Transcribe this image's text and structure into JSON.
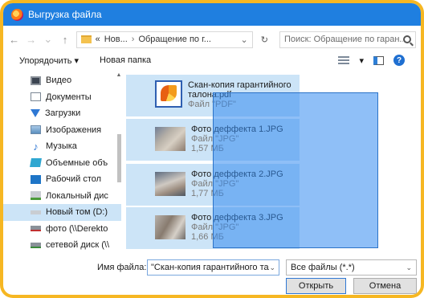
{
  "window": {
    "title": "Выгрузка файла"
  },
  "address": {
    "back_glyph": "←",
    "forward_glyph": "→",
    "history_glyph": "⌄",
    "up_glyph": "↑",
    "prefix": "«",
    "crumbs": [
      "Нов...",
      "Обращение по г..."
    ],
    "separator": "›",
    "dropdown_glyph": "⌄",
    "refresh_glyph": "↻",
    "search_placeholder": "Поиск: Обращение по гаран..."
  },
  "toolbar": {
    "organize_label": "Упорядочить ▾",
    "new_folder_label": "Новая папка",
    "view_dropdown_glyph": "▾",
    "help_glyph": "?"
  },
  "sidebar": {
    "items": [
      {
        "label": "Видео",
        "icon": "video-icon"
      },
      {
        "label": "Документы",
        "icon": "documents-icon"
      },
      {
        "label": "Загрузки",
        "icon": "downloads-icon"
      },
      {
        "label": "Изображения",
        "icon": "images-icon"
      },
      {
        "label": "Музыка",
        "icon": "music-icon"
      },
      {
        "label": "Объемные объ",
        "icon": "3d-objects-icon"
      },
      {
        "label": "Рабочий стол",
        "icon": "desktop-icon"
      },
      {
        "label": "Локальный дис",
        "icon": "local-disk-icon"
      },
      {
        "label": "Новый том (D:)",
        "icon": "drive-icon",
        "selected": true
      },
      {
        "label": "фото (\\\\Derekto",
        "icon": "network-drive-icon"
      },
      {
        "label": "сетевой диск (\\\\",
        "icon": "network-drive-icon"
      }
    ],
    "music_glyph": "♪",
    "scroll_up": "▲",
    "scroll_down": "▼"
  },
  "files": [
    {
      "name_line1": "Скан-копия гарантийного",
      "name_line2": "талона.pdf",
      "type": "Файл \"PDF\"",
      "size": ""
    },
    {
      "name_line1": "Фото деффекта 1.JPG",
      "name_line2": "",
      "type": "Файл \"JPG\"",
      "size": "1,57 МБ"
    },
    {
      "name_line1": "Фото деффекта 2.JPG",
      "name_line2": "",
      "type": "Файл \"JPG\"",
      "size": "1,77 МБ"
    },
    {
      "name_line1": "Фото деффекта 3.JPG",
      "name_line2": "",
      "type": "Файл \"JPG\"",
      "size": "1,66 МБ"
    }
  ],
  "bottom": {
    "filename_label": "Имя файла:",
    "filename_value": "\"Скан-копия гарантийного тал",
    "filetype_value": "Все файлы (*.*)",
    "dropdown_glyph": "⌄",
    "open_label": "Открыть",
    "cancel_label": "Отмена"
  },
  "colors": {
    "titlebar": "#1f7fe0",
    "frame": "#f6b722",
    "selection": "#cce4f7",
    "drag_rect": "#338bf0"
  }
}
